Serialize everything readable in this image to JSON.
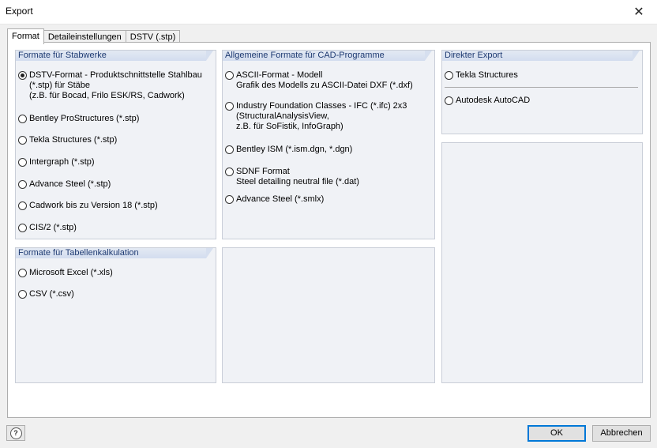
{
  "window": {
    "title": "Export",
    "close_glyph": "✕"
  },
  "tabs": [
    "Format",
    "Detaileinstellungen",
    "DSTV (.stp)"
  ],
  "groups": {
    "stabwerke": {
      "title": "Formate für Stabwerke",
      "options": [
        {
          "lines": [
            "DSTV-Format - Produktschnittstelle Stahlbau",
            "(*.stp) für Stäbe",
            "(z.B. für Bocad, Frilo ESK/RS, Cadwork)"
          ],
          "selected": true
        },
        {
          "lines": [
            "Bentley ProStructures (*.stp)"
          ],
          "selected": false
        },
        {
          "lines": [
            "Tekla Structures (*.stp)"
          ],
          "selected": false
        },
        {
          "lines": [
            "Intergraph (*.stp)"
          ],
          "selected": false
        },
        {
          "lines": [
            "Advance Steel (*.stp)"
          ],
          "selected": false
        },
        {
          "lines": [
            "Cadwork bis zu Version 18 (*.stp)"
          ],
          "selected": false
        },
        {
          "lines": [
            "CIS/2 (*.stp)"
          ],
          "selected": false
        }
      ]
    },
    "cad": {
      "title": "Allgemeine Formate für CAD-Programme",
      "options": [
        {
          "lines": [
            "ASCII-Format - Modell",
            "Grafik des Modells zu ASCII-Datei DXF (*.dxf)"
          ],
          "selected": false
        },
        {
          "lines": [
            "Industry Foundation Classes - IFC (*.ifc) 2x3",
            "(StructuralAnalysisView,",
            "z.B. für SoFistik, InfoGraph)"
          ],
          "selected": false
        },
        {
          "lines": [
            "Bentley ISM (*.ism.dgn, *.dgn)"
          ],
          "selected": false
        },
        {
          "lines": [
            "SDNF Format",
            "Steel detailing neutral file (*.dat)"
          ],
          "selected": false
        },
        {
          "lines": [
            "Advance Steel (*.smlx)"
          ],
          "selected": false
        }
      ]
    },
    "direkt": {
      "title": "Direkter Export",
      "options": [
        {
          "lines": [
            "Tekla Structures"
          ],
          "selected": false
        },
        {
          "lines": [
            "Autodesk AutoCAD"
          ],
          "selected": false
        }
      ]
    },
    "tabellen": {
      "title": "Formate für Tabellenkalkulation",
      "options": [
        {
          "lines": [
            "Microsoft Excel (*.xls)"
          ],
          "selected": false
        },
        {
          "lines": [
            "CSV (*.csv)"
          ],
          "selected": false
        }
      ]
    }
  },
  "footer": {
    "help_glyph": "?",
    "ok": "OK",
    "cancel": "Abbrechen"
  }
}
